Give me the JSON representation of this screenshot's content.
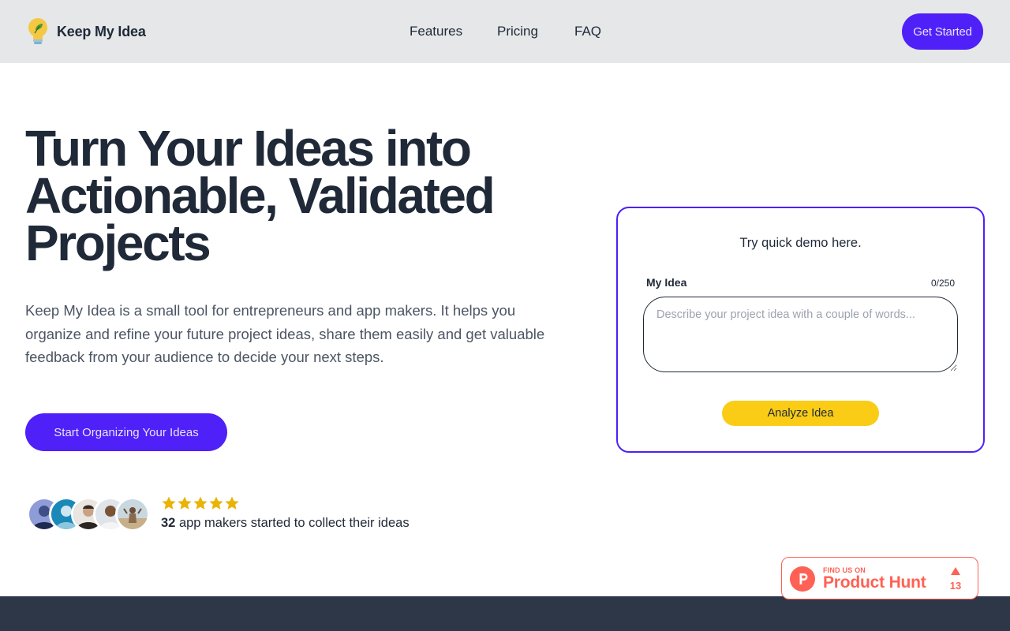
{
  "header": {
    "brand_name": "Keep My Idea",
    "nav": [
      {
        "label": "Features"
      },
      {
        "label": "Pricing"
      },
      {
        "label": "FAQ"
      }
    ],
    "cta_label": "Get Started"
  },
  "hero": {
    "title": "Turn Your Ideas into Actionable, Validated Projects",
    "description": "Keep My Idea is a small tool for entrepreneurs and app makers. It helps you organize and refine your future project ideas, share them easily and get valuable feedback from your audience to decide your next steps.",
    "cta_label": "Start Organizing Your Ideas"
  },
  "social_proof": {
    "rating_stars": 5,
    "count": "32",
    "text": " app makers started to collect their ideas",
    "avatar_count": 5
  },
  "demo": {
    "title": "Try quick demo here.",
    "field_label": "My Idea",
    "char_count": "0/250",
    "input_value": "",
    "input_placeholder": "Describe your project idea with a couple of words...",
    "button_label": "Analyze Idea"
  },
  "product_hunt": {
    "eyebrow": "FIND US ON",
    "name": "Product Hunt",
    "votes": "13"
  },
  "colors": {
    "accent": "#4f20f7",
    "accent_text": "#e7e3ff",
    "yellow": "#facc15",
    "text_dark": "#1f2937",
    "header_bg": "#e5e7e8",
    "footer_bg": "#2d3748",
    "product_hunt": "#ff6154",
    "star": "#eab308"
  },
  "icons": {
    "brand": "lightbulb-icon",
    "rating": "star-icon",
    "product_hunt_logo": "product-hunt-icon",
    "upvote": "upvote-arrow-icon"
  }
}
